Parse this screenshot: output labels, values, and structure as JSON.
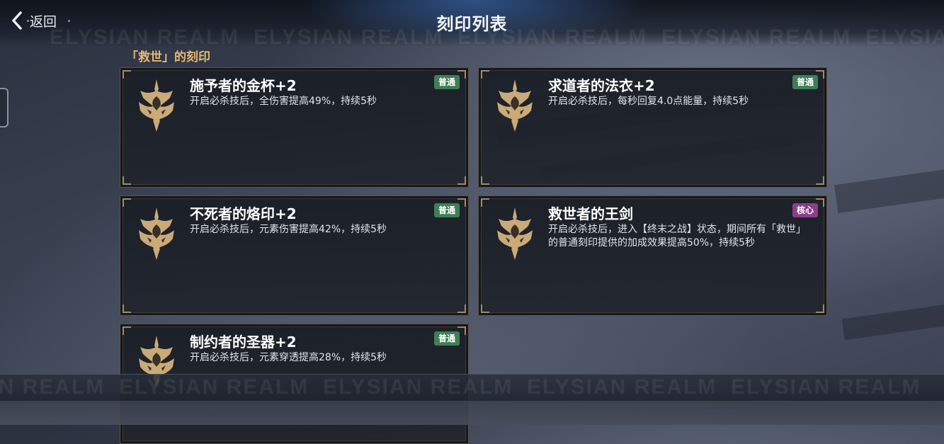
{
  "header": {
    "back_label": "返回",
    "title": "刻印列表"
  },
  "watermark": "ELYSIAN REALM",
  "section_title": "「救世」的刻印",
  "colors": {
    "accent_gold": "#e6b777",
    "badge_normal": "#3f7f56",
    "badge_core": "#8a3f86"
  },
  "cards": [
    {
      "name": "施予者的金杯+2",
      "desc": "开启必杀技后，全伤害提高49%，持续5秒",
      "badge": "普通",
      "badge_type": "normal",
      "icon": "saviour-emblem-icon"
    },
    {
      "name": "求道者的法衣+2",
      "desc": "开启必杀技后，每秒回复4.0点能量，持续5秒",
      "badge": "普通",
      "badge_type": "normal",
      "icon": "saviour-emblem-icon"
    },
    {
      "name": "不死者的烙印+2",
      "desc": "开启必杀技后，元素伤害提高42%，持续5秒",
      "badge": "普通",
      "badge_type": "normal",
      "icon": "saviour-emblem-icon"
    },
    {
      "name": "救世者的王剑",
      "desc": "开启必杀技后，进入【终末之战】状态，期间所有「救世」的普通刻印提供的加成效果提高50%，持续5秒",
      "badge": "核心",
      "badge_type": "core",
      "icon": "saviour-emblem-icon"
    },
    {
      "name": "制约者的圣器+2",
      "desc": "开启必杀技后，元素穿透提高28%，持续5秒",
      "badge": "普通",
      "badge_type": "normal",
      "icon": "saviour-emblem-icon"
    }
  ]
}
